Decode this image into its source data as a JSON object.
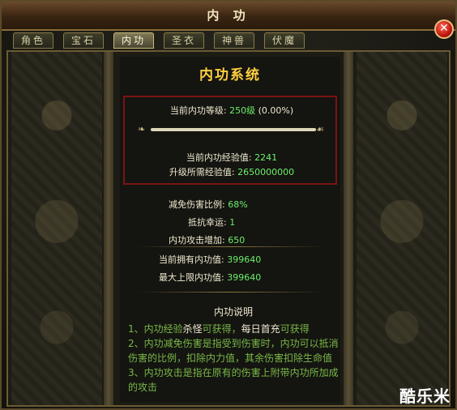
{
  "window": {
    "title": "内 功"
  },
  "tabs": [
    {
      "label": "角色"
    },
    {
      "label": "宝石"
    },
    {
      "label": "内功"
    },
    {
      "label": "圣衣"
    },
    {
      "label": "神兽"
    },
    {
      "label": "伏魔"
    }
  ],
  "active_tab": "内功",
  "close_icon": "close-icon",
  "system": {
    "title": "内功系统",
    "level_label": "当前内功等级:",
    "level_value": "250级",
    "level_percent": "(0.00%)",
    "progress_fraction": 0.0,
    "cur_exp_label": "当前内功经验值:",
    "cur_exp_value": "2241",
    "need_exp_label": "升级所需经验值:",
    "need_exp_value": "2650000000"
  },
  "stats": [
    {
      "label": "减免伤害比例:",
      "value": "68%"
    },
    {
      "label": "抵抗幸运:",
      "value": "1"
    },
    {
      "label": "内功攻击增加:",
      "value": "650"
    },
    {
      "label": "当前拥有内功值:",
      "value": "399640"
    },
    {
      "label": "最大上限内功值:",
      "value": "399640"
    }
  ],
  "description": {
    "title": "内功说明",
    "line1": {
      "a": "1、内功经验",
      "b": "杀怪",
      "c": "可获得，",
      "d": "每日首充",
      "e": "可获得"
    },
    "line2": "2、内功减免伤害是指受到伤害时，内功可以抵消伤害的比例，扣除内力值，其余伤害扣除生命值",
    "line3": "3、内功攻击是指在原有的伤害上附带内功所加成的攻击"
  },
  "watermark": "酷乐米"
}
